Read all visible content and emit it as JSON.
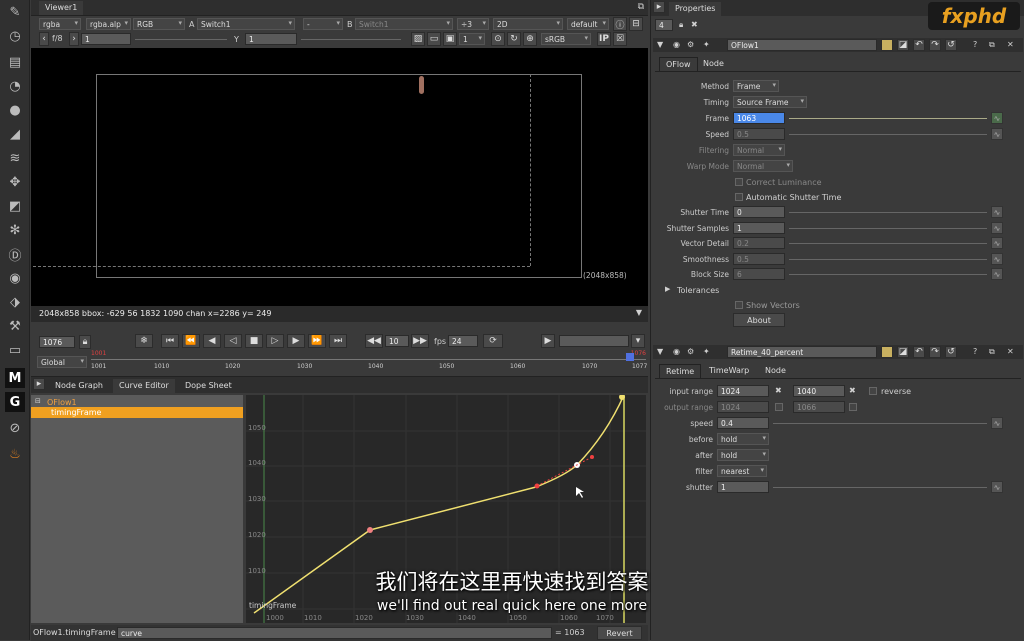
{
  "left_tools": [
    "paint-icon",
    "clock-icon",
    "channel-icon",
    "color-icon",
    "circle-icon",
    "filter-icon",
    "layers-icon",
    "transform-icon",
    "cube-icon",
    "particles-icon",
    "deep-icon",
    "views-icon",
    "metadata-icon",
    "toolsets-icon",
    "other-icon",
    "m-icon",
    "g-icon",
    "furnace-icon",
    "fire-icon"
  ],
  "viewer": {
    "tab": "Viewer1",
    "channels": "rgba",
    "layer": "rgba.alp",
    "colorspace": "RGB",
    "a_label": "A",
    "a_input": "Switch1",
    "compare": "-",
    "b_label": "B",
    "b_input": "Switch1",
    "proxy": "÷3",
    "mode": "2D",
    "lut": "default",
    "fstop": "f/8",
    "gain": "1",
    "gamma_label": "Y",
    "gamma": "1",
    "frame_inc": "1",
    "display": "sRGB",
    "resolution": "(2048x858)",
    "info": "2048x858 bbox: -629 56 1832 1090 chan  x=2286 y= 249"
  },
  "timeline": {
    "frame": "1076",
    "range": "Global",
    "step": "10",
    "fps_label": "fps",
    "fps": "24",
    "start_marker": "1001",
    "end_marker": "1076",
    "ticks": [
      "1001",
      "1010",
      "1020",
      "1030",
      "1040",
      "1050",
      "1060",
      "1070",
      "1077"
    ]
  },
  "bottom_panel": {
    "tabs": [
      "Node Graph",
      "Curve Editor",
      "Dope Sheet"
    ],
    "tree": {
      "root": "OFlow1",
      "child": "timingFrame"
    },
    "y_ticks": [
      "1050",
      "1040",
      "1030",
      "1020",
      "1010"
    ],
    "x_ticks": [
      "1000",
      "1010",
      "1020",
      "1030",
      "1040",
      "1050",
      "1060",
      "1070"
    ],
    "curve_label": "timingFrame",
    "status_path": "OFlow1.timingFrame",
    "status_expr": "curve",
    "status_value": "= 1063",
    "revert": "Revert"
  },
  "properties": {
    "title": "Properties",
    "count": "4",
    "oflow": {
      "name": "OFlow1",
      "tabs": [
        "OFlow",
        "Node"
      ],
      "method_label": "Method",
      "method": "Frame",
      "timing_label": "Timing",
      "timing": "Source Frame",
      "frame_label": "Frame",
      "frame": "1063",
      "speed_label": "Speed",
      "speed": "0.5",
      "filtering_label": "Filtering",
      "filtering": "Normal",
      "warp_label": "Warp Mode",
      "warp": "Normal",
      "correct_lum": "Correct Luminance",
      "auto_shutter": "Automatic Shutter Time",
      "shutter_time_label": "Shutter Time",
      "shutter_time": "0",
      "shutter_samples_label": "Shutter Samples",
      "shutter_samples": "1",
      "vector_detail_label": "Vector Detail",
      "vector_detail": "0.2",
      "smoothness_label": "Smoothness",
      "smoothness": "0.5",
      "block_size_label": "Block Size",
      "block_size": "6",
      "tolerances": "Tolerances",
      "show_vectors": "Show Vectors",
      "about": "About"
    },
    "retime": {
      "name": "Retime_40_percent",
      "tabs": [
        "Retime",
        "TimeWarp",
        "Node"
      ],
      "input_label": "input range",
      "input_a": "1024",
      "input_b": "1040",
      "reverse": "reverse",
      "output_label": "output range",
      "output_a": "1024",
      "output_b": "1066",
      "speed_label": "speed",
      "speed": "0.4",
      "before_label": "before",
      "before": "hold",
      "after_label": "after",
      "after": "hold",
      "filter_label": "filter",
      "filter": "nearest",
      "shutter_label": "shutter",
      "shutter": "1"
    }
  },
  "logo": "fxphd",
  "subtitle_cn": "我们将在这里再快速找到答案",
  "subtitle_en": "we'll find out real quick here one more"
}
